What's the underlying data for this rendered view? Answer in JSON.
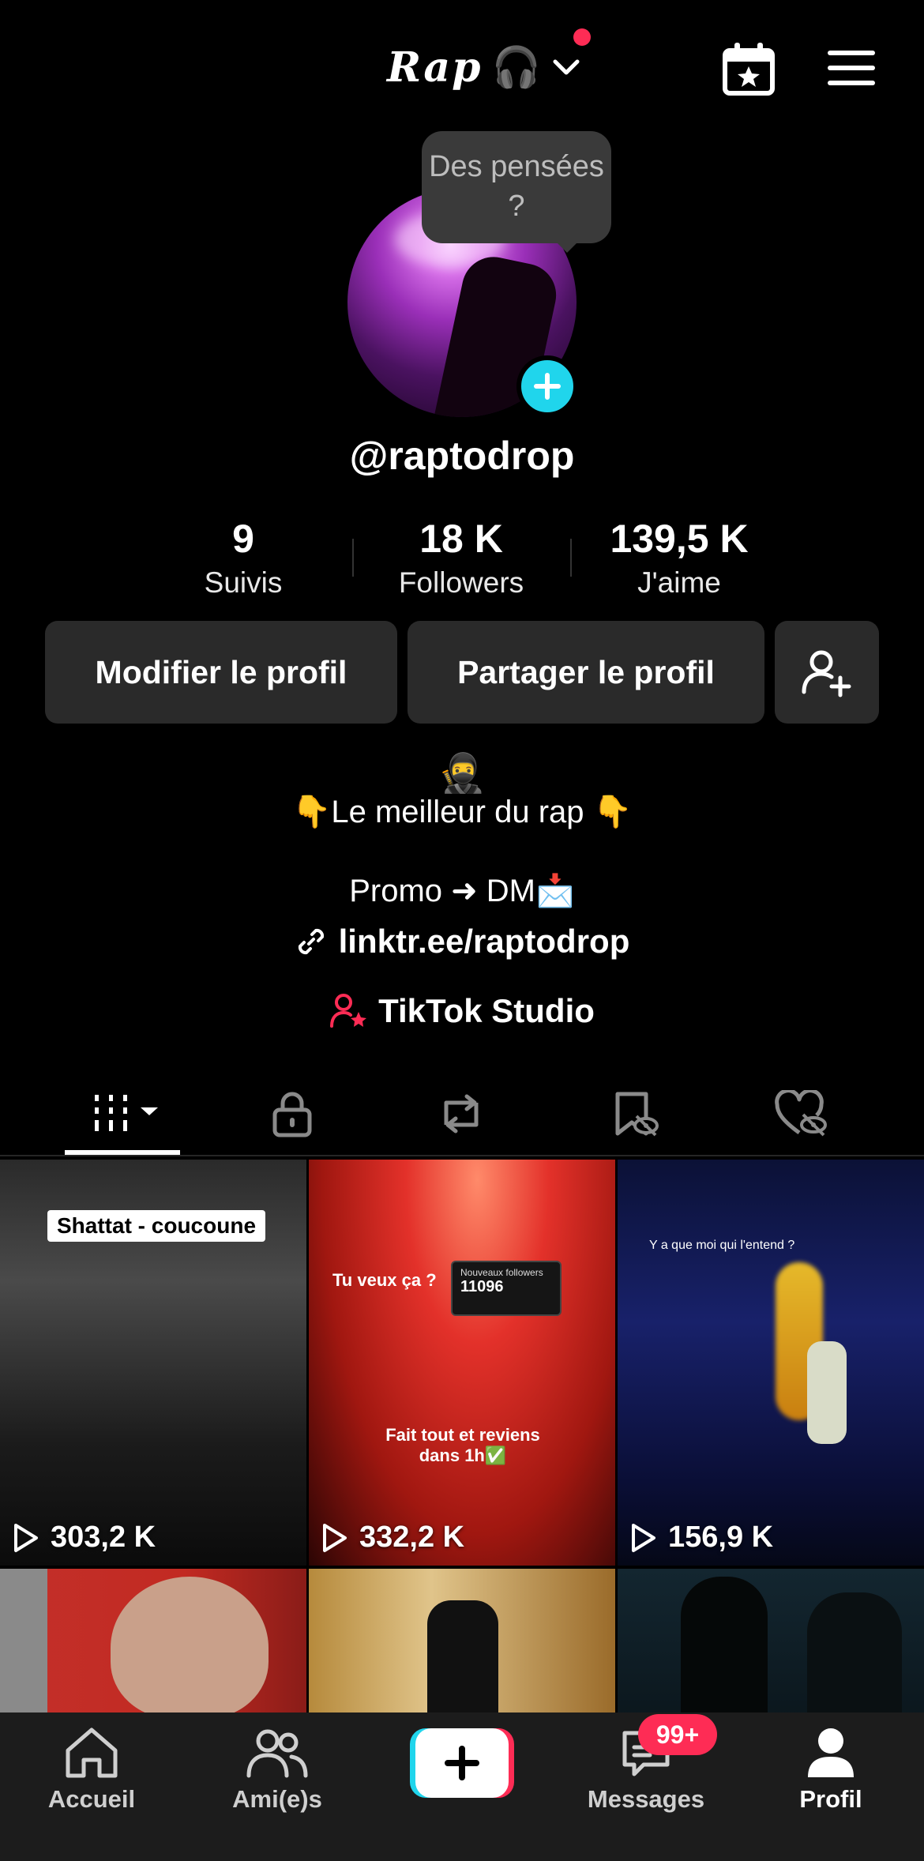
{
  "header": {
    "account_name": "Rap",
    "account_emoji": "🎧",
    "calendar_icon": "calendar-star-icon",
    "menu_icon": "hamburger-menu-icon"
  },
  "profile": {
    "tooltip": "Des pensées ?",
    "username": "@raptodrop",
    "stats": [
      {
        "value": "9",
        "label": "Suivis"
      },
      {
        "value": "18 K",
        "label": "Followers"
      },
      {
        "value": "139,5 K",
        "label": "J'aime"
      }
    ],
    "edit_label": "Modifier le profil",
    "share_label": "Partager le profil",
    "bio_emoji": "🥷",
    "bio_line1": "👇Le meilleur du rap  👇",
    "bio_line2": "Promo ➜ DM📩",
    "link": "linktr.ee/raptodrop",
    "studio_label": "TikTok Studio"
  },
  "tabs": [
    "videos-grid",
    "private",
    "reposts",
    "favorites",
    "liked"
  ],
  "videos": [
    {
      "views": "303,2 K",
      "caption": "Shattat - coucoune"
    },
    {
      "views": "332,2 K",
      "caption_top": "Tu veux ça ?",
      "notif_title": "Nouveaux followers",
      "notif_value": "11096",
      "caption_bottom": "Fait tout et reviens dans 1h✅"
    },
    {
      "views": "156,9 K",
      "caption": "Y a que moi qui l'entend ?"
    },
    {
      "views": ""
    },
    {
      "views": ""
    },
    {
      "views": ""
    }
  ],
  "nav": {
    "home": "Accueil",
    "friends": "Ami(e)s",
    "messages": "Messages",
    "messages_badge": "99+",
    "profile": "Profil"
  },
  "colors": {
    "accent_red": "#fe2c55",
    "accent_cyan": "#20d5ec",
    "button_bg": "#2a2a2a"
  }
}
